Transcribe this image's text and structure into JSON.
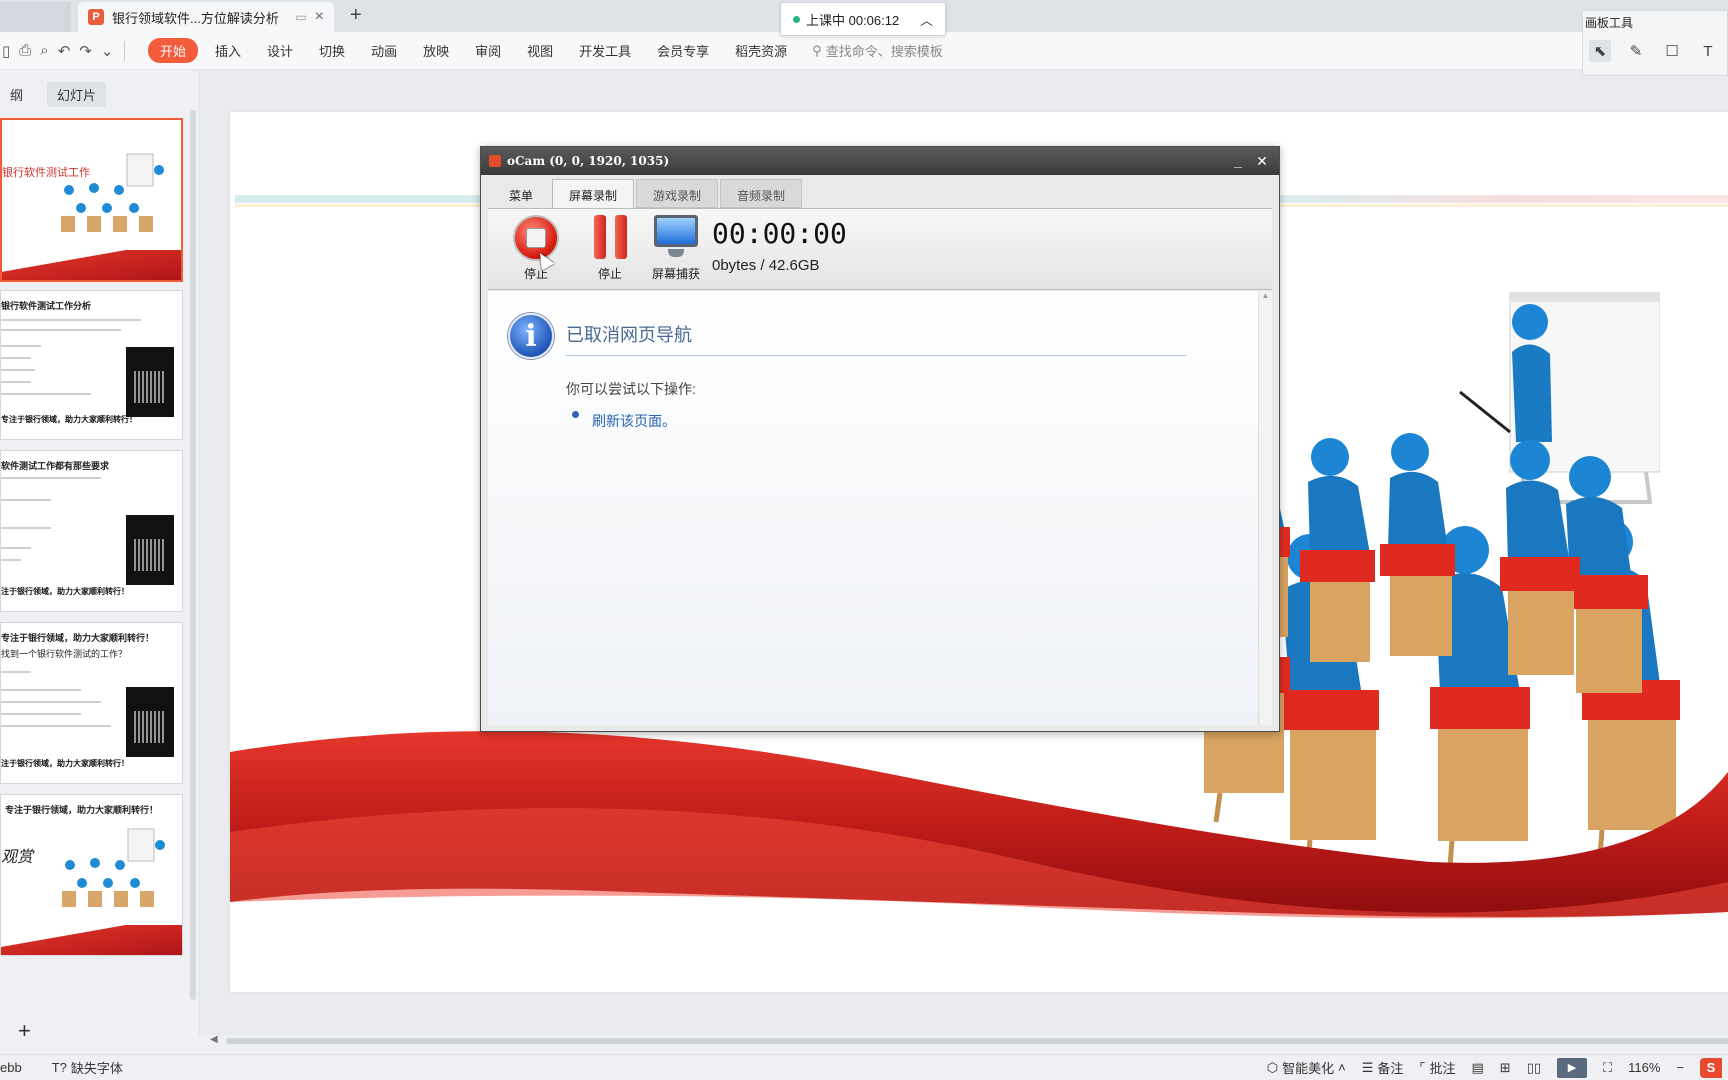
{
  "tabbar": {
    "doc_tab_title": "银行领域软件...方位解读分析",
    "new_tab_label": "+",
    "close_label": "×"
  },
  "live_pill": {
    "status": "上课中 00:06:12"
  },
  "ribbon": {
    "menu": [
      "开始",
      "插入",
      "设计",
      "切换",
      "动画",
      "放映",
      "审阅",
      "视图",
      "开发工具",
      "会员专享",
      "稻壳资源"
    ],
    "search_placeholder": "查找命令、搜索模板"
  },
  "pen_tools": {
    "title": "画板工具",
    "icons": [
      "select-icon",
      "pen-icon",
      "rectangle-icon",
      "text-icon"
    ]
  },
  "left_panel": {
    "view_tabs": [
      "纲",
      "幻灯片"
    ],
    "thumbnails": [
      {
        "title": "银行软件测试工作"
      },
      {
        "title": "银行软件测试工作分析",
        "footer": "专注于银行领域，助力大家顺利转行！"
      },
      {
        "title": "软件测试工作都有那些要求",
        "footer": "注于银行领域，助力大家顺利转行！"
      },
      {
        "title": "专注于银行领域，助力大家顺利转行！",
        "subtitle": "找到一个银行软件测试的工作？",
        "footer": "注于银行领域，助力大家顺利转行！"
      },
      {
        "title": "专注于银行领域，助力大家顺利转行！",
        "subtitle": "观赏"
      }
    ],
    "add_label": "+"
  },
  "ocam": {
    "title": "oCam (0, 0, 1920, 1035)",
    "tabs": [
      "菜单",
      "屏幕录制",
      "游戏录制",
      "音频录制"
    ],
    "buttons": {
      "stop": "停止",
      "pause": "停止",
      "capture": "屏幕捕获"
    },
    "timer": "00:00:00",
    "size": "0bytes / 42.6GB",
    "content": {
      "title": "已取消网页导航",
      "hint": "你可以尝试以下操作:",
      "link": "刷新该页面。"
    }
  },
  "statusbar": {
    "left": [
      "ebb",
      "缺失字体"
    ],
    "beautify": "智能美化",
    "notes": "备注",
    "comments": "批注",
    "zoom": "116%",
    "zoom_minus": "−"
  },
  "colors": {
    "accent": "#f25b3c",
    "wave_red": "#c8201b",
    "ocam_title": "#3a3a3a"
  }
}
